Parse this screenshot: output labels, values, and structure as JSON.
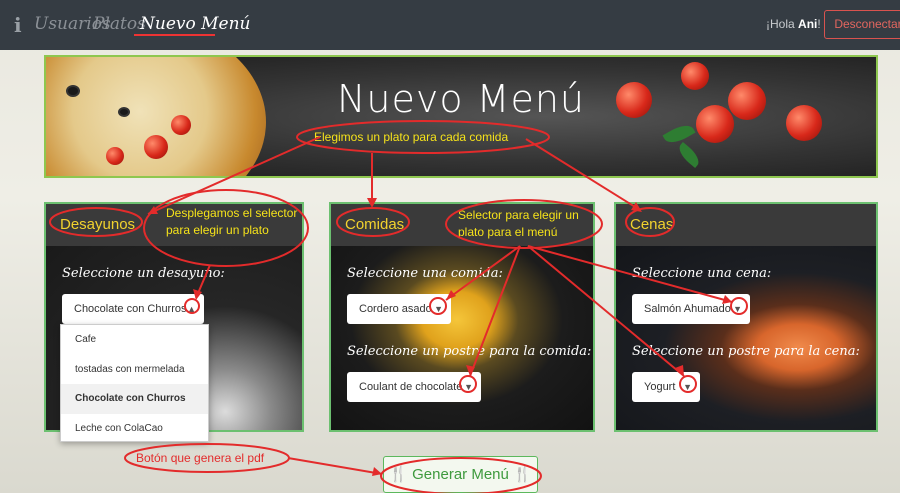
{
  "nav": {
    "info_icon": "i",
    "links": [
      "Usuarios",
      "Platos",
      "Nuevo Menú"
    ],
    "greeting": "¡Hola",
    "user": "Ani",
    "logout": "Desconectar"
  },
  "hero": {
    "title": "Nuevo Menú"
  },
  "cards": {
    "desayunos": {
      "title": "Desayunos",
      "label": "Seleccione un desayuno:",
      "selected": "Chocolate con Churros",
      "options": [
        "Cafe",
        "tostadas con mermelada",
        "Chocolate con Churros",
        "Leche con ColaCao"
      ]
    },
    "comidas": {
      "title": "Comidas",
      "label": "Seleccione una comida:",
      "selected": "Cordero asado",
      "postre_label": "Seleccione un postre para la comida:",
      "postre_selected": "Coulant de chocolate"
    },
    "cenas": {
      "title": "Cenas",
      "label": "Seleccione una cena:",
      "selected": "Salmón Ahumado",
      "postre_label": "Seleccione un postre para la cena:",
      "postre_selected": "Yogurt"
    }
  },
  "generate_button": "Generar Menú",
  "annotations": {
    "a1": "Elegimos un plato para cada comida",
    "a2": "Desplegamos el selector para elegir un plato",
    "a3": "Selector para elegir un plato para el menú",
    "a4": "Botón que genera el pdf"
  },
  "colors": {
    "accent": "#f2d22e",
    "annotation": "#e32b2b",
    "border": "#6cc070",
    "button": "#3e9a3e"
  }
}
